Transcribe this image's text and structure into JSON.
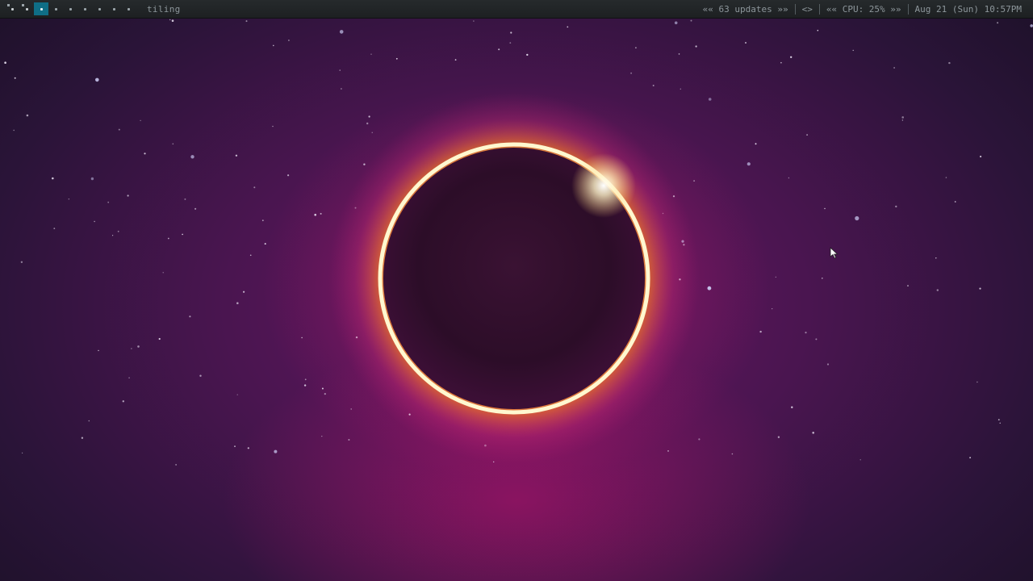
{
  "topbar": {
    "tags": [
      {
        "name": "tag-1",
        "state": "occupied"
      },
      {
        "name": "tag-2",
        "state": "occupied"
      },
      {
        "name": "tag-3",
        "state": "active"
      },
      {
        "name": "tag-4",
        "state": "empty"
      },
      {
        "name": "tag-5",
        "state": "empty"
      },
      {
        "name": "tag-6",
        "state": "empty"
      },
      {
        "name": "tag-7",
        "state": "empty"
      },
      {
        "name": "tag-8",
        "state": "empty"
      },
      {
        "name": "tag-9",
        "state": "empty"
      }
    ],
    "layout_label": "tiling",
    "updates_label": "«« 63 updates »»",
    "layout_toggle_label": "<>",
    "cpu_label": "«« CPU: 25% »»",
    "clock_label": "Aug 21 (Sun) 10:57PM"
  },
  "colors": {
    "bar_bg": "#1f2224",
    "active_tag": "#0f6e86",
    "bar_text": "#8d969b",
    "corona": "#ffd060",
    "sky": "#4a1550"
  },
  "desktop": {
    "wallpaper": "solar-eclipse",
    "cursor": "arrow-pointer"
  }
}
